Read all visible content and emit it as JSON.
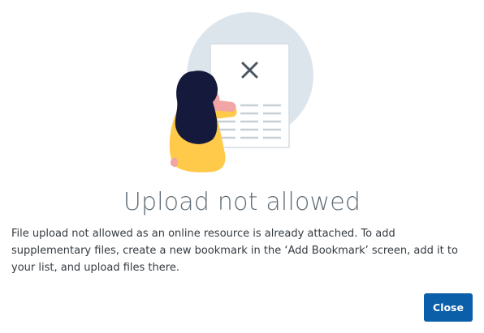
{
  "dialog": {
    "title": "Upload not allowed",
    "message": "File upload not allowed as an online resource is already attached. To add supplementary files, create a new bookmark in the ‘Add Bookmark’ screen, add it to your list, and upload files there.",
    "close_label": "Close"
  },
  "colors": {
    "accent": "#0b5ea8",
    "circle": "#dde5ec",
    "hair": "#151a3d",
    "shirt": "#ffc94a",
    "skin": "#f2a5a5"
  }
}
